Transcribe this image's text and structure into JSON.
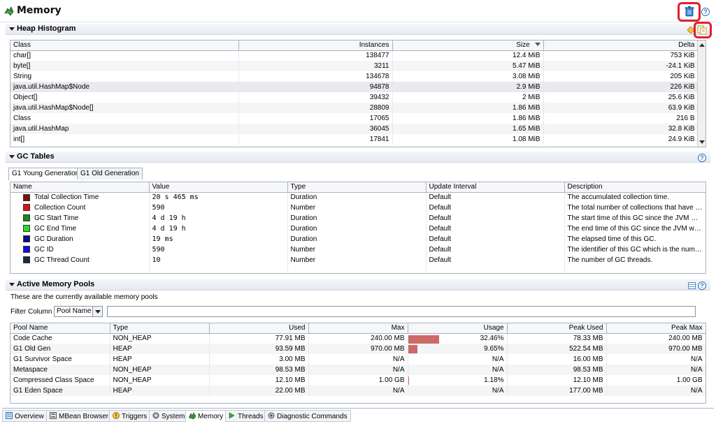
{
  "header": {
    "title": "Memory"
  },
  "heap": {
    "section_title": "Heap Histogram",
    "columns": [
      "Class",
      "Instances",
      "Size",
      "Delta"
    ],
    "sort_column": "Size",
    "rows": [
      [
        "char[]",
        "138477",
        "12.4 MiB",
        "753 KiB"
      ],
      [
        "byte[]",
        "3211",
        "5.47 MiB",
        "-24.1 KiB"
      ],
      [
        "String",
        "134678",
        "3.08 MiB",
        "205 KiB"
      ],
      [
        "java.util.HashMap$Node",
        "94878",
        "2.9 MiB",
        "226 KiB"
      ],
      [
        "Object[]",
        "39432",
        "2 MiB",
        "25.6 KiB"
      ],
      [
        "java.util.HashMap$Node[]",
        "28809",
        "1.86 MiB",
        "63.9 KiB"
      ],
      [
        "Class",
        "17065",
        "1.86 MiB",
        "216 B"
      ],
      [
        "java.util.HashMap",
        "36045",
        "1.65 MiB",
        "32.8 KiB"
      ],
      [
        "int[]",
        "17841",
        "1.08 MiB",
        "24.9 KiB"
      ]
    ]
  },
  "gc": {
    "section_title": "GC Tables",
    "tabs": [
      "G1 Young Generation",
      "G1 Old Generation"
    ],
    "columns": [
      "Name",
      "Value",
      "Type",
      "Update Interval",
      "Description"
    ],
    "rows": [
      {
        "color": "#7a1010",
        "name": "Total Collection Time",
        "value": "20 s 465 ms",
        "type": "Duration",
        "interval": "Default",
        "desc": "The accumulated collection time."
      },
      {
        "color": "#e01010",
        "name": "Collection Count",
        "value": "590",
        "type": "Number",
        "interval": "Default",
        "desc": "The total number of collections that have o..."
      },
      {
        "color": "#178a17",
        "name": "GC Start Time",
        "value": "4 d 19 h",
        "type": "Duration",
        "interval": "Default",
        "desc": "The start time of this GC since the JVM was ..."
      },
      {
        "color": "#22e022",
        "name": "GC End Time",
        "value": "4 d 19 h",
        "type": "Duration",
        "interval": "Default",
        "desc": "The end time of this GC since the JVM was ..."
      },
      {
        "color": "#0c0c80",
        "name": "GC Duration",
        "value": "19 ms",
        "type": "Duration",
        "interval": "Default",
        "desc": "The elapsed time of this GC."
      },
      {
        "color": "#1010e0",
        "name": "GC ID",
        "value": "590",
        "type": "Number",
        "interval": "Default",
        "desc": "The identifier of this GC which is the numb..."
      },
      {
        "color": "#1c2a3c",
        "name": "GC Thread Count",
        "value": "10",
        "type": "Number",
        "interval": "Default",
        "desc": "The number of GC threads."
      }
    ]
  },
  "pools": {
    "section_title": "Active Memory Pools",
    "subtitle": "These are the currently available memory pools",
    "filter_label": "Filter Column",
    "filter_value": "Pool Name",
    "columns": [
      "Pool Name",
      "Type",
      "Used",
      "Max",
      "Usage",
      "Peak Used",
      "Peak Max"
    ],
    "rows": [
      {
        "name": "Code Cache",
        "type": "NON_HEAP",
        "used": "77.91 MB",
        "max": "240.00 MB",
        "usage": "32.46%",
        "usage_frac": 0.3246,
        "peak_used": "78.33 MB",
        "peak_max": "240.00 MB"
      },
      {
        "name": "G1 Old Gen",
        "type": "HEAP",
        "used": "93.59 MB",
        "max": "970.00 MB",
        "usage": "9.65%",
        "usage_frac": 0.0965,
        "peak_used": "522.54 MB",
        "peak_max": "970.00 MB"
      },
      {
        "name": "G1 Survivor Space",
        "type": "HEAP",
        "used": "3.00 MB",
        "max": "N/A",
        "usage": "N/A",
        "usage_frac": 0,
        "peak_used": "16.00 MB",
        "peak_max": "N/A"
      },
      {
        "name": "Metaspace",
        "type": "NON_HEAP",
        "used": "98.53 MB",
        "max": "N/A",
        "usage": "N/A",
        "usage_frac": 0,
        "peak_used": "98.53 MB",
        "peak_max": "N/A"
      },
      {
        "name": "Compressed Class Space",
        "type": "NON_HEAP",
        "used": "12.10 MB",
        "max": "1.00 GB",
        "usage": "1.18%",
        "usage_frac": 0.0118,
        "peak_used": "12.10 MB",
        "peak_max": "1.00 GB"
      },
      {
        "name": "G1 Eden Space",
        "type": "HEAP",
        "used": "22.00 MB",
        "max": "N/A",
        "usage": "N/A",
        "usage_frac": 0,
        "peak_used": "177.00 MB",
        "peak_max": "N/A"
      }
    ]
  },
  "bottom_tabs": [
    "Overview",
    "MBean Browser",
    "Triggers",
    "System",
    "Memory",
    "Threads",
    "Diagnostic Commands"
  ],
  "active_bottom_tab": "Memory",
  "icons": {
    "title": "memory-icon",
    "gc_button": "trash-icon",
    "help": "help-icon",
    "copy": "copy-icon",
    "refresh": "diamond-icon",
    "layout": "columns-icon"
  },
  "colors": {
    "usage_bar": "#cd6a67",
    "highlight": "#e0202c"
  }
}
